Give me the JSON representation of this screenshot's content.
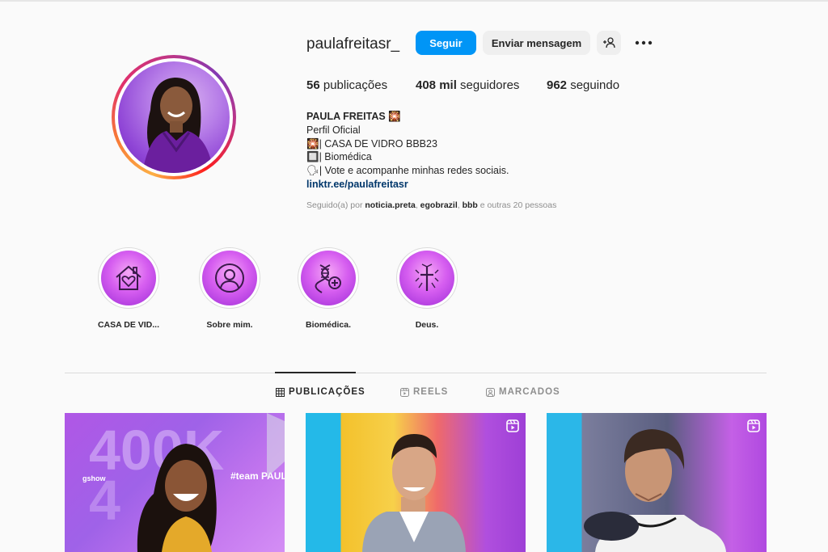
{
  "profile": {
    "username": "paulafreitasr_",
    "follow_label": "Seguir",
    "message_label": "Enviar mensagem",
    "add_person_icon": "add-person-icon",
    "more_icon": "more-options-icon"
  },
  "stats": {
    "posts_count": "56",
    "posts_label": " publicações",
    "followers_count": "408 mil",
    "followers_label": " seguidores",
    "following_count": "962",
    "following_label": " seguindo"
  },
  "bio": {
    "name": "PAULA FREITAS 🎇",
    "category": "Perfil Oficial",
    "line1": "🎇| CASA DE VIDRO BBB23",
    "line2": "🔲| Biomédica",
    "line3": "🗣| Vote e acompanhe minhas redes sociais.",
    "link": "linktr.ee/paulafreitasr"
  },
  "followed_by": {
    "prefix": "Seguido(a) por ",
    "user1": "noticia.preta",
    "sep1": ", ",
    "user2": "egobrazil",
    "sep2": ", ",
    "user3": "bbb",
    "suffix": " e outras 20 pessoas"
  },
  "highlights": [
    {
      "label": "CASA DE VID...",
      "icon": "house-heart-icon"
    },
    {
      "label": "Sobre mim.",
      "icon": "user-circle-icon"
    },
    {
      "label": "Biomédica.",
      "icon": "dna-icon"
    },
    {
      "label": "Deus.",
      "icon": "cross-icon"
    }
  ],
  "tabs": [
    {
      "label": "PUBLICAÇÕES",
      "icon": "grid-icon",
      "active": true
    },
    {
      "label": "REELS",
      "icon": "reels-icon",
      "active": false
    },
    {
      "label": "MARCADOS",
      "icon": "tagged-icon",
      "active": false
    }
  ],
  "posts": [
    {
      "type": "image",
      "overlay_big": "400K",
      "tag": "#team PAULA",
      "brand": "gshow"
    },
    {
      "type": "reel",
      "icon": "reel-icon"
    },
    {
      "type": "reel",
      "icon": "reel-icon"
    }
  ],
  "colors": {
    "accent": "#0095f6",
    "link": "#00376b",
    "highlight_purple": "#b23ee0"
  }
}
